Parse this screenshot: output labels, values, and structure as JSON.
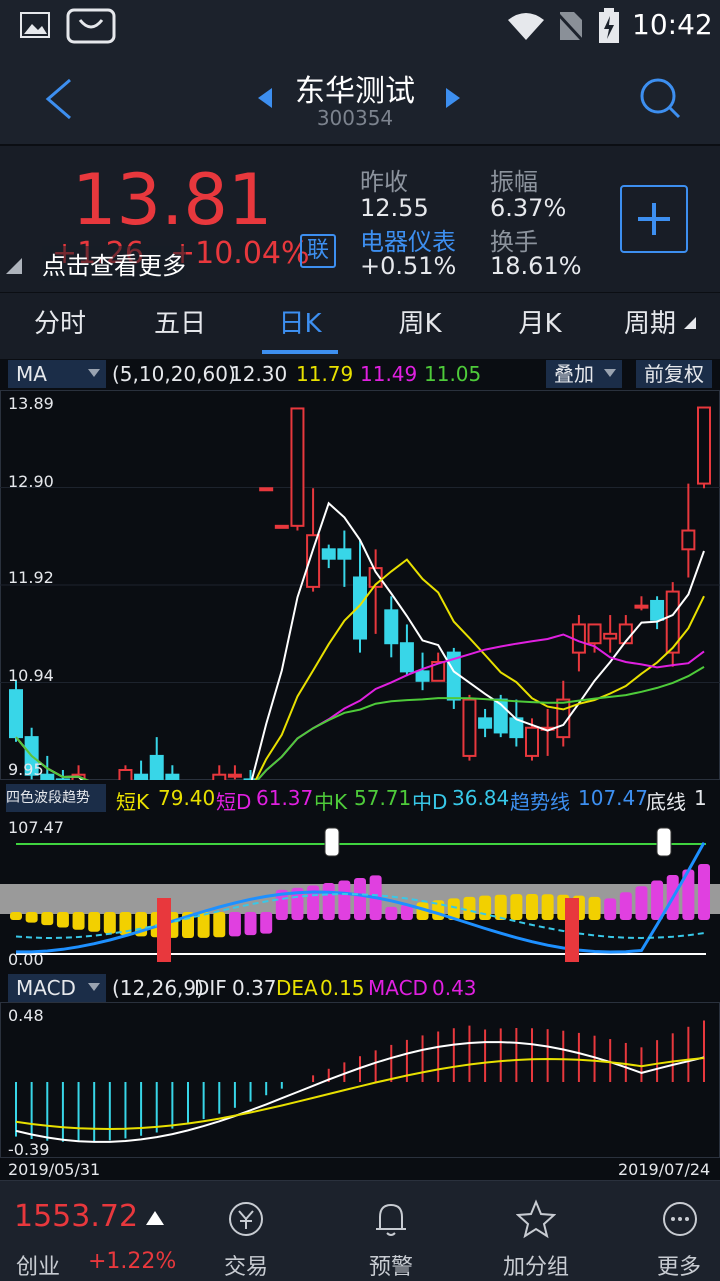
{
  "status_bar": {
    "time": "10:42"
  },
  "header": {
    "title": "东华测试",
    "code": "300354"
  },
  "quote": {
    "price": "13.81",
    "change": "+1.26",
    "change_pct": "+10.04%",
    "link_badge": "联",
    "hint": "点击查看更多",
    "prev_close_label": "昨收",
    "prev_close": "12.55",
    "sector_label": "电器仪表",
    "sector_change": "+0.51%",
    "amplitude_label": "振幅",
    "amplitude": "6.37%",
    "turnover_label": "换手",
    "turnover": "18.61%",
    "price_color": "#e8383d"
  },
  "tabs": [
    "分时",
    "五日",
    "日K",
    "周K",
    "月K",
    "周期"
  ],
  "active_tab": "日K",
  "main_chart": {
    "indicator": "MA",
    "params": "(5,10,20,60)",
    "ma_values": [
      "12.30",
      "11.79",
      "11.49",
      "11.05"
    ],
    "overlay_btn": "叠加",
    "adjust_btn": "前复权",
    "y_labels": [
      "13.89",
      "12.90",
      "11.92",
      "10.94",
      "9.95"
    ]
  },
  "wave_chart": {
    "indicator": "四色波段趋势",
    "items": [
      {
        "label": "短K",
        "value": "79.40",
        "color": "#e8e000"
      },
      {
        "label": "短D",
        "value": "61.37",
        "color": "#e020e0"
      },
      {
        "label": "中K",
        "value": "57.71",
        "color": "#4ecb3a"
      },
      {
        "label": "中D",
        "value": "36.84",
        "color": "#38c8e8"
      },
      {
        "label": "趋势线",
        "value": "107.47",
        "color": "#3d8ff0"
      },
      {
        "label": "底线",
        "value": "1",
        "color": "#e6e8ec"
      }
    ],
    "y_labels": [
      "107.47",
      "0.00"
    ]
  },
  "macd_chart": {
    "indicator": "MACD",
    "params": "(12,26,9)",
    "items": [
      {
        "label": "DIF",
        "value": "0.37",
        "color": "#e6e8ec"
      },
      {
        "label": "DEA",
        "value": "0.15",
        "color": "#e8e000"
      },
      {
        "label": "MACD",
        "value": "0.43",
        "color": "#e020e0"
      }
    ],
    "y_labels": [
      "0.48",
      "-0.39"
    ],
    "date_start": "2019/05/31",
    "date_end": "2019/07/24"
  },
  "bottom_bar": {
    "index_value": "1553.72",
    "index_name": "创业",
    "index_change": "+1.22%",
    "items": [
      "交易",
      "预警",
      "加分组",
      "更多"
    ]
  },
  "chart_data": {
    "type": "candlestick",
    "start_date": "2019/05/31",
    "end_date": "2019/07/24",
    "ylim": [
      9.95,
      13.89
    ],
    "ma_legend": [
      "MA5 12.30",
      "MA10 11.79",
      "MA20 11.49",
      "MA60 11.05"
    ],
    "candles": [
      [
        10.8,
        10.3,
        10.9,
        10.25
      ],
      [
        10.3,
        9.9,
        10.4,
        9.85
      ],
      [
        9.9,
        9.7,
        10.1,
        9.6
      ],
      [
        9.85,
        9.6,
        9.95,
        9.55
      ],
      [
        9.6,
        9.9,
        10.0,
        9.5
      ],
      [
        9.7,
        9.45,
        9.8,
        9.35
      ],
      [
        9.4,
        9.6,
        9.7,
        9.3
      ],
      [
        9.75,
        9.95,
        10.0,
        9.6
      ],
      [
        9.9,
        9.7,
        10.05,
        9.6
      ],
      [
        10.1,
        9.7,
        10.3,
        9.6
      ],
      [
        9.9,
        9.4,
        10.0,
        9.3
      ],
      [
        9.45,
        9.7,
        9.75,
        9.35
      ],
      [
        9.65,
        9.7,
        9.8,
        9.55
      ],
      [
        9.8,
        9.9,
        10.0,
        9.7
      ],
      [
        9.9,
        9.9,
        10.0,
        9.85
      ],
      [
        9.85,
        9.75,
        9.95,
        9.6
      ],
      [
        12.95,
        12.95,
        12.95,
        12.95
      ],
      [
        12.55,
        12.55,
        12.55,
        12.55
      ],
      [
        12.55,
        13.8,
        13.8,
        12.5
      ],
      [
        11.9,
        12.45,
        12.95,
        11.85
      ],
      [
        12.3,
        12.2,
        12.35,
        12.1
      ],
      [
        12.3,
        12.2,
        12.5,
        11.9
      ],
      [
        12.0,
        11.35,
        12.4,
        11.2
      ],
      [
        11.9,
        12.1,
        12.3,
        11.4
      ],
      [
        11.65,
        11.3,
        11.8,
        11.15
      ],
      [
        11.3,
        11.0,
        11.5,
        10.95
      ],
      [
        11.0,
        10.9,
        11.2,
        10.8
      ],
      [
        10.9,
        11.1,
        11.2,
        10.9
      ],
      [
        11.2,
        10.7,
        11.25,
        10.6
      ],
      [
        10.1,
        10.7,
        10.75,
        10.05
      ],
      [
        10.5,
        10.4,
        10.6,
        10.3
      ],
      [
        10.7,
        10.35,
        10.75,
        10.3
      ],
      [
        10.5,
        10.3,
        10.7,
        10.2
      ],
      [
        10.1,
        10.4,
        10.5,
        10.05
      ],
      [
        10.4,
        10.4,
        10.6,
        10.1
      ],
      [
        10.3,
        10.7,
        10.9,
        10.2
      ],
      [
        11.2,
        11.5,
        11.6,
        11.0
      ],
      [
        11.3,
        11.5,
        11.5,
        11.2
      ],
      [
        11.35,
        11.4,
        11.6,
        11.2
      ],
      [
        11.3,
        11.5,
        11.6,
        11.3
      ],
      [
        11.7,
        11.7,
        11.8,
        11.65
      ],
      [
        11.75,
        11.55,
        11.8,
        11.45
      ],
      [
        11.2,
        11.85,
        11.95,
        11.05
      ],
      [
        12.3,
        12.5,
        13.0,
        12.0
      ],
      [
        13.0,
        13.81,
        13.81,
        12.95
      ]
    ]
  }
}
